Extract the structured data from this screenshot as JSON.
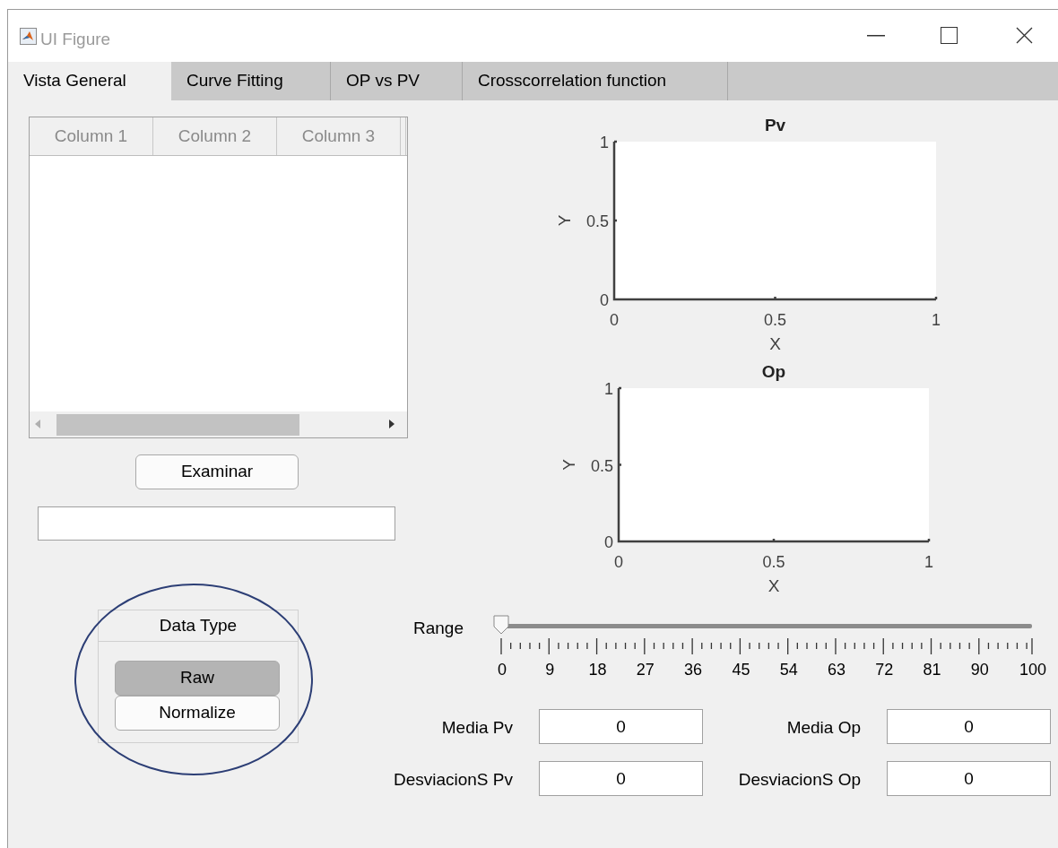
{
  "window": {
    "title": "UI Figure"
  },
  "tabs": [
    {
      "label": "Vista General",
      "selected": true
    },
    {
      "label": "Curve Fitting",
      "selected": false
    },
    {
      "label": "OP vs PV",
      "selected": false
    },
    {
      "label": "Crosscorrelation function",
      "selected": false
    }
  ],
  "table": {
    "columns": [
      "Column 1",
      "Column 2",
      "Column 3"
    ]
  },
  "examinar_button": "Examinar",
  "data_type": {
    "title": "Data Type",
    "options": [
      {
        "label": "Raw",
        "selected": true
      },
      {
        "label": "Normalize",
        "selected": false
      }
    ]
  },
  "charts": [
    {
      "chart_data": {
        "type": "line",
        "title": "Pv",
        "xlabel": "X",
        "ylabel": "Y",
        "xlim": [
          0,
          1
        ],
        "ylim": [
          0,
          1
        ],
        "xticks": [
          {
            "value": 0,
            "label": "0"
          },
          {
            "value": 0.5,
            "label": "0.5"
          },
          {
            "value": 1,
            "label": "1"
          }
        ],
        "yticks": [
          {
            "value": 0,
            "label": "0"
          },
          {
            "value": 0.5,
            "label": "0.5"
          },
          {
            "value": 1,
            "label": "1"
          }
        ]
      }
    },
    {
      "chart_data": {
        "type": "line",
        "title": "Op",
        "xlabel": "X",
        "ylabel": "Y",
        "xlim": [
          0,
          1
        ],
        "ylim": [
          0,
          1
        ],
        "xticks": [
          {
            "value": 0,
            "label": "0"
          },
          {
            "value": 0.5,
            "label": "0.5"
          },
          {
            "value": 1,
            "label": "1"
          }
        ],
        "yticks": [
          {
            "value": 0,
            "label": "0"
          },
          {
            "value": 0.5,
            "label": "0.5"
          },
          {
            "value": 1,
            "label": "1"
          }
        ]
      }
    }
  ],
  "range_slider": {
    "label": "Range",
    "level": 0,
    "tick_labels": [
      "0",
      "9",
      "18",
      "27",
      "36",
      "45",
      "54",
      "63",
      "72",
      "81",
      "90",
      "100"
    ]
  },
  "stats": [
    {
      "label": "Media Pv",
      "value": "0"
    },
    {
      "label": "Media Op",
      "value": "0"
    },
    {
      "label": "DesviacionS Pv",
      "value": "0"
    },
    {
      "label": "DesviacionS Op",
      "value": "0"
    }
  ],
  "highlight_ellipse": true
}
